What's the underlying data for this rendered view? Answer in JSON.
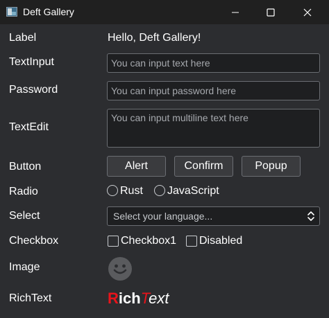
{
  "window": {
    "title": "Deft Gallery"
  },
  "icons": {
    "app": "app-window-icon",
    "minimize": "minimize-icon",
    "maximize": "maximize-icon",
    "close": "close-icon",
    "select_arrow": "up-down-chevron-icon",
    "image": "smiley-face-icon"
  },
  "rows": {
    "label": {
      "label": "Label",
      "value": "Hello, Deft Gallery!"
    },
    "textinput": {
      "label": "TextInput",
      "placeholder": "You can input text here"
    },
    "password": {
      "label": "Password",
      "placeholder": "You can input password here"
    },
    "textedit": {
      "label": "TextEdit",
      "placeholder": "You can input multiline text here"
    },
    "button": {
      "label": "Button",
      "buttons": [
        "Alert",
        "Confirm",
        "Popup"
      ]
    },
    "radio": {
      "label": "Radio",
      "options": [
        "Rust",
        "JavaScript"
      ]
    },
    "select": {
      "label": "Select",
      "value": "Select your language..."
    },
    "checkbox": {
      "label": "Checkbox",
      "options": [
        "Checkbox1",
        "Disabled"
      ]
    },
    "image": {
      "label": "Image"
    },
    "richtext": {
      "label": "RichText",
      "parts": [
        "R",
        "ich",
        "T",
        "ext"
      ]
    }
  },
  "colors": {
    "background": "#2c2d30",
    "titlebar": "#202020",
    "field_background": "#1e1f21",
    "border": "#6b6e73",
    "rich_red": "#e8141b",
    "text": "#ffffff"
  }
}
